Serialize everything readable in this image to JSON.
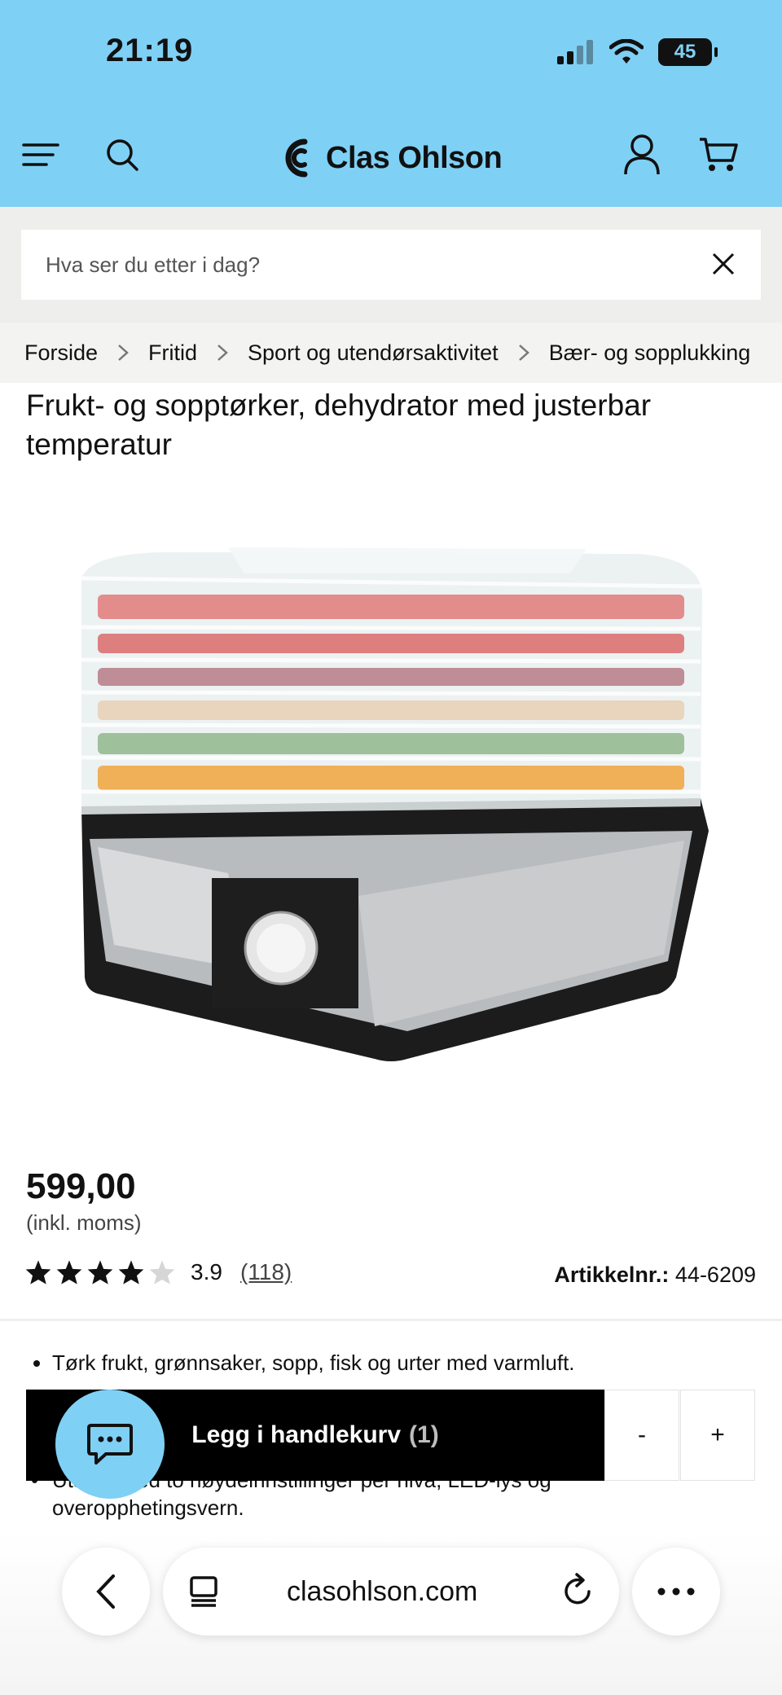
{
  "status_bar": {
    "time": "21:19",
    "battery": "45"
  },
  "header": {
    "brand": "Clas Ohlson",
    "icons": [
      "menu-icon",
      "search-icon",
      "account-icon",
      "cart-icon"
    ],
    "background": "#7fd0f5"
  },
  "search": {
    "placeholder": "Hva ser du etter i dag?"
  },
  "breadcrumb": [
    "Forside",
    "Fritid",
    "Sport og utendørsaktivitet",
    "Bær- og sopplukking"
  ],
  "product": {
    "title": "Frukt- og sopptørker, dehydrator med justerbar temperatur",
    "price": "599,00",
    "vat_note": "(inkl. moms)",
    "rating_value": "3.9",
    "rating_count": "(118)",
    "rating_stars": 3.9,
    "sku_label": "Artikkelnr.:",
    "sku": "44-6209",
    "bullets": [
      "Tørk frukt, grønnsaker, sopp, fisk og urter med varmluft."
    ],
    "bullet_partial": "Utstyrt med to høydeinnstillinger per nivå, LED-lys og overopphetingsvern."
  },
  "cart": {
    "label": "Legg i handlekurv",
    "qty": "(1)",
    "minus": "-",
    "plus": "+"
  },
  "browser": {
    "url": "clasohlson.com"
  }
}
